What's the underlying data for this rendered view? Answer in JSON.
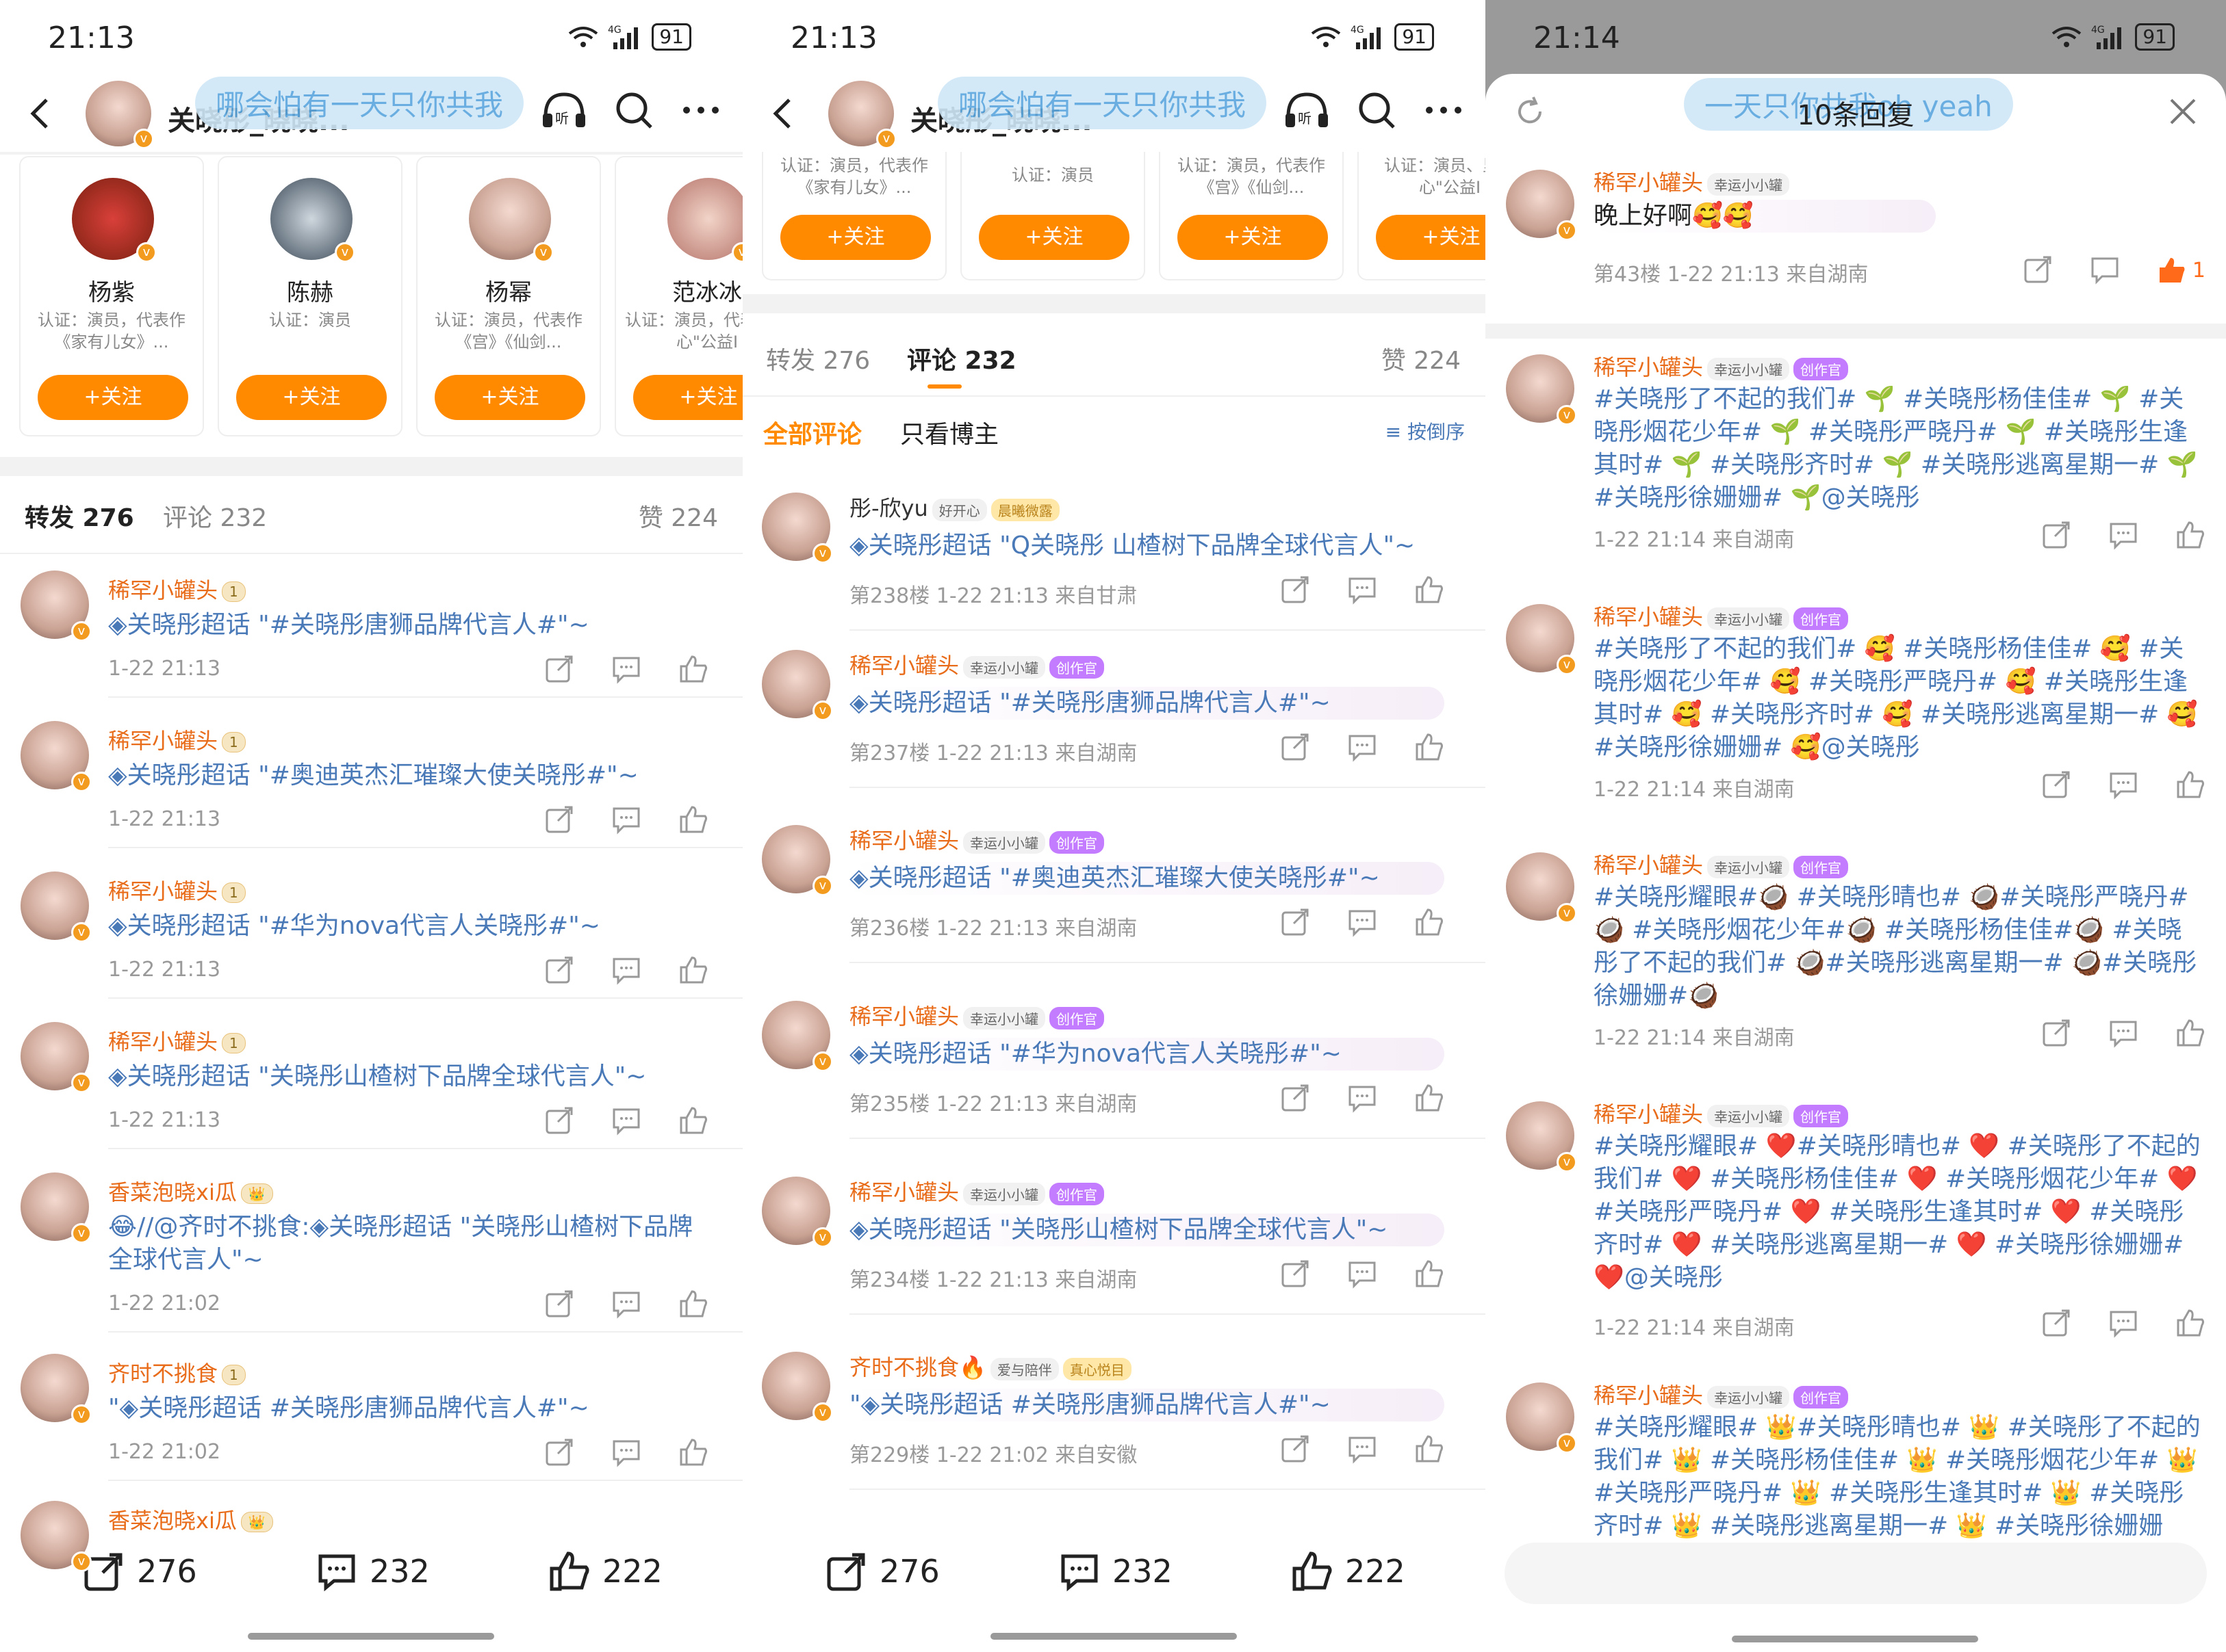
{
  "status": {
    "time1": "21:13",
    "time2": "21:13",
    "time3": "21:14",
    "battery": "91",
    "network": "4G"
  },
  "header": {
    "name1": "关晓彤_晓晓...",
    "name2": "关晓彤_晓晓...",
    "lyric1": "哪会怕有一天只你共我",
    "lyric2": "哪会怕有一天只你共我",
    "lyric3": "一天只你共我oh yeah",
    "listen": "听"
  },
  "recommend": [
    {
      "name": "杨紫",
      "desc": "认证：演员，代表作《家有儿女》...",
      "follow": "+关注"
    },
    {
      "name": "陈赫",
      "desc": "认证：演员",
      "follow": "+关注"
    },
    {
      "name": "杨幂",
      "desc": "认证：演员，代表作《宫》《仙剑...",
      "follow": "+关注"
    },
    {
      "name": "范冰冰",
      "desc": "认证：演员，代表里的心\"公益I",
      "follow": "+关注"
    }
  ],
  "recommend2": [
    {
      "desc": "认证：演员，代表作《家有儿女》...",
      "follow": "+关注"
    },
    {
      "desc": "认证：演员",
      "follow": "+关注"
    },
    {
      "desc": "认证：演员，代表作《宫》《仙剑...",
      "follow": "+关注"
    },
    {
      "desc": "认证：演员、里的心\"公益I",
      "follow": "+关注"
    }
  ],
  "tabs1": {
    "repost": "转发 276",
    "comment": "评论 232",
    "like": "赞 224"
  },
  "tabs2": {
    "repost": "转发 276",
    "comment": "评论 232",
    "like": "赞 224",
    "all": "全部评论",
    "only": "只看博主",
    "sort": "按倒序"
  },
  "reposts": [
    {
      "user": "稀罕小罐头",
      "badge": "1",
      "text": "◈关晓彤超话 \"#关晓彤唐狮品牌代言人#\"~",
      "meta": "1-22 21:13"
    },
    {
      "user": "稀罕小罐头",
      "badge": "1",
      "text": "◈关晓彤超话 \"#奥迪英杰汇璀璨大使关晓彤#\"~",
      "meta": "1-22 21:13"
    },
    {
      "user": "稀罕小罐头",
      "badge": "1",
      "text": "◈关晓彤超话 \"#华为nova代言人关晓彤#\"~",
      "meta": "1-22 21:13"
    },
    {
      "user": "稀罕小罐头",
      "badge": "1",
      "text": "◈关晓彤超话 \"关晓彤山楂树下品牌全球代言人\"~",
      "meta": "1-22 21:13"
    },
    {
      "user": "香菜泡晓xi瓜",
      "badge": "👑",
      "text": "😂//@齐时不挑食:◈关晓彤超话 \"关晓彤山楂树下品牌全球代言人\"~",
      "meta": "1-22 21:02"
    },
    {
      "user": "齐时不挑食",
      "badge": "1",
      "text": "\"◈关晓彤超话 #关晓彤唐狮品牌代言人#\"~",
      "meta": "1-22 21:02"
    },
    {
      "user": "香菜泡晓xi瓜",
      "badge": "👑",
      "text": "",
      "meta": ""
    }
  ],
  "comments": [
    {
      "user": "彤-欣yu",
      "badges": [
        "好开心",
        "晨曦微露"
      ],
      "text": "◈关晓彤超话 \"Q关晓彤 山楂树下品牌全球代言人\"~",
      "meta": "第238楼 1-22 21:13 来自甘肃"
    },
    {
      "user": "稀罕小罐头",
      "badges": [
        "幸运小小罐",
        "创作官"
      ],
      "text": "◈关晓彤超话 \"#关晓彤唐狮品牌代言人#\"~",
      "meta": "第237楼 1-22 21:13 来自湖南"
    },
    {
      "user": "稀罕小罐头",
      "badges": [
        "幸运小小罐",
        "创作官"
      ],
      "text": "◈关晓彤超话 \"#奥迪英杰汇璀璨大使关晓彤#\"~",
      "meta": "第236楼 1-22 21:13 来自湖南"
    },
    {
      "user": "稀罕小罐头",
      "badges": [
        "幸运小小罐",
        "创作官"
      ],
      "text": "◈关晓彤超话 \"#华为nova代言人关晓彤#\"~",
      "meta": "第235楼 1-22 21:13 来自湖南"
    },
    {
      "user": "稀罕小罐头",
      "badges": [
        "幸运小小罐",
        "创作官"
      ],
      "text": "◈关晓彤超话 \"关晓彤山楂树下品牌全球代言人\"~",
      "meta": "第234楼 1-22 21:13 来自湖南"
    },
    {
      "user": "齐时不挑食🔥",
      "badges": [
        "爱与陪伴",
        "真心悦目"
      ],
      "text": "\"◈关晓彤超话 #关晓彤唐狮品牌代言人#\"~",
      "meta": "第229楼 1-22 21:02 来自安徽"
    }
  ],
  "bottom": {
    "repost": "276",
    "comment": "232",
    "like": "222"
  },
  "sheet": {
    "title": "10条回复",
    "main": {
      "user": "稀罕小罐头",
      "badge": "幸运小小罐",
      "text": "晚上好啊🥰🥰",
      "meta": "第43楼 1-22 21:13 来自湖南",
      "likes": "1"
    },
    "replies": [
      {
        "user": "稀罕小罐头",
        "badges": [
          "幸运小小罐",
          "创作官"
        ],
        "text": "#关晓彤了不起的我们# 🌱 #关晓彤杨佳佳# 🌱 #关晓彤烟花少年# 🌱 #关晓彤严晓丹# 🌱 #关晓彤生逢其时# 🌱 #关晓彤齐时# 🌱 #关晓彤逃离星期一# 🌱 #关晓彤徐姗姗# 🌱@关晓彤",
        "meta": "1-22 21:14 来自湖南"
      },
      {
        "user": "稀罕小罐头",
        "badges": [
          "幸运小小罐",
          "创作官"
        ],
        "text": "#关晓彤了不起的我们# 🥰 #关晓彤杨佳佳# 🥰 #关晓彤烟花少年# 🥰 #关晓彤严晓丹# 🥰 #关晓彤生逢其时# 🥰 #关晓彤齐时# 🥰 #关晓彤逃离星期一# 🥰 #关晓彤徐姗姗# 🥰@关晓彤",
        "meta": "1-22 21:14 来自湖南"
      },
      {
        "user": "稀罕小罐头",
        "badges": [
          "幸运小小罐",
          "创作官"
        ],
        "text": "#关晓彤耀眼#🥥 #关晓彤晴也# 🥥#关晓彤严晓丹# 🥥 #关晓彤烟花少年#🥥 #关晓彤杨佳佳#🥥 #关晓彤了不起的我们# 🥥#关晓彤逃离星期一# 🥥#关晓彤徐姗姗#🥥",
        "meta": "1-22 21:14 来自湖南"
      },
      {
        "user": "稀罕小罐头",
        "badges": [
          "幸运小小罐",
          "创作官"
        ],
        "text": "#关晓彤耀眼# ❤️#关晓彤晴也# ❤️ #关晓彤了不起的我们# ❤️ #关晓彤杨佳佳# ❤️ #关晓彤烟花少年# ❤️ #关晓彤严晓丹# ❤️ #关晓彤生逢其时# ❤️ #关晓彤齐时# ❤️ #关晓彤逃离星期一# ❤️ #关晓彤徐姗姗# ❤️@关晓彤",
        "meta": "1-22 21:14 来自湖南"
      },
      {
        "user": "稀罕小罐头",
        "badges": [
          "幸运小小罐",
          "创作官"
        ],
        "text": "#关晓彤耀眼# 👑#关晓彤晴也# 👑 #关晓彤了不起的我们# 👑 #关晓彤杨佳佳# 👑 #关晓彤烟花少年# 👑 #关晓彤严晓丹# 👑 #关晓彤生逢其时# 👑 #关晓彤齐时# 👑 #关晓彤逃离星期一# 👑 #关晓彤徐姗姗",
        "meta": ""
      }
    ]
  },
  "colors": {
    "accent": "#ff8a00",
    "username": "#e86c1a",
    "link": "#4a79b8",
    "meta": "#999999"
  }
}
